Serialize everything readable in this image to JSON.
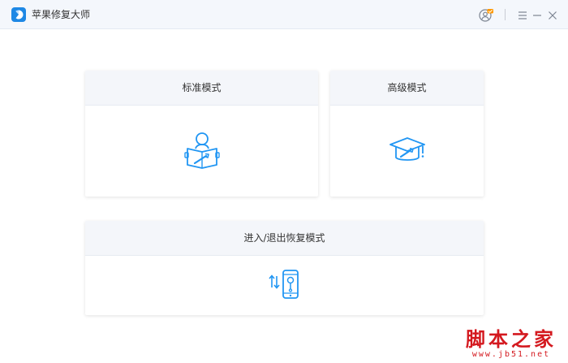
{
  "app": {
    "title": "苹果修复大师",
    "logo_icon": "app-logo-icon",
    "accent_color": "#1e88e5"
  },
  "titlebar": {
    "user_icon": "user-icon",
    "user_badge_color": "#ff9800",
    "menu_icon": "menu-icon",
    "minimize_icon": "minimize-icon",
    "close_icon": "close-icon"
  },
  "modes": [
    {
      "label": "标准模式",
      "icon": "reader-wrench-icon"
    },
    {
      "label": "高级模式",
      "icon": "graduation-cap-icon"
    },
    {
      "label": "进入/退出恢复模式",
      "icon": "phone-recovery-icon"
    }
  ],
  "watermark": {
    "main": "脚本之家",
    "sub": "www.jb51.net"
  }
}
